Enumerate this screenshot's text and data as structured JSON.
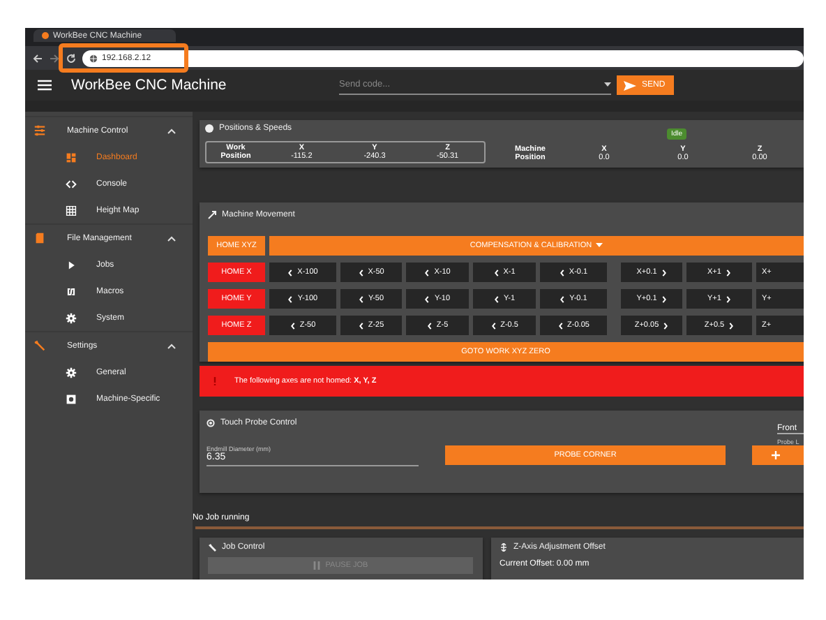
{
  "browser": {
    "tab_title": "WorkBee CNC Machine",
    "url": "192.168.2.12"
  },
  "header": {
    "title": "WorkBee CNC Machine",
    "command": {
      "placeholder": "Send code..."
    },
    "send_button": "SEND"
  },
  "sidebar": {
    "sections": [
      {
        "label": "Machine Control",
        "expanded": true,
        "children": [
          {
            "label": "Dashboard",
            "selected": true
          },
          {
            "label": "Console",
            "selected": false
          },
          {
            "label": "Height Map",
            "selected": false
          }
        ]
      },
      {
        "label": "File Management",
        "expanded": true,
        "children": [
          {
            "label": "Jobs",
            "selected": false
          },
          {
            "label": "Macros",
            "selected": false
          },
          {
            "label": "System",
            "selected": false
          }
        ]
      },
      {
        "label": "Settings",
        "expanded": true,
        "children": [
          {
            "label": "General",
            "selected": false
          },
          {
            "label": "Machine-Specific",
            "selected": false
          }
        ]
      }
    ]
  },
  "positions": {
    "title": "Positions & Speeds",
    "status": "Idle",
    "work": {
      "label_1": "Work",
      "label_2": "Position",
      "columns": [
        {
          "axis": "X",
          "value": "-115.2"
        },
        {
          "axis": "Y",
          "value": "-240.3"
        },
        {
          "axis": "Z",
          "value": "-50.31"
        }
      ]
    },
    "machine": {
      "label_1": "Machine",
      "label_2": "Position",
      "columns": [
        {
          "axis": "X",
          "value": "0.0"
        },
        {
          "axis": "Y",
          "value": "0.0"
        },
        {
          "axis": "Z",
          "value": "0.00"
        }
      ]
    }
  },
  "movement": {
    "title": "Machine Movement",
    "home_all": "HOME XYZ",
    "calibration": "COMPENSATION & CALIBRATION",
    "rows": [
      {
        "home": "HOME X",
        "jogs": [
          {
            "label": "X-100",
            "kind": "minus"
          },
          {
            "label": "X-50",
            "kind": "minus"
          },
          {
            "label": "X-10",
            "kind": "minus"
          },
          {
            "label": "X-1",
            "kind": "minus"
          },
          {
            "label": "X-0.1",
            "kind": "minus"
          },
          {
            "label": "X+0.1",
            "kind": "plus"
          },
          {
            "label": "X+1",
            "kind": "plus"
          },
          {
            "label": "X+",
            "kind": "cut"
          }
        ]
      },
      {
        "home": "HOME Y",
        "jogs": [
          {
            "label": "Y-100",
            "kind": "minus"
          },
          {
            "label": "Y-50",
            "kind": "minus"
          },
          {
            "label": "Y-10",
            "kind": "minus"
          },
          {
            "label": "Y-1",
            "kind": "minus"
          },
          {
            "label": "Y-0.1",
            "kind": "minus"
          },
          {
            "label": "Y+0.1",
            "kind": "plus"
          },
          {
            "label": "Y+1",
            "kind": "plus"
          },
          {
            "label": "Y+",
            "kind": "cut"
          }
        ]
      },
      {
        "home": "HOME Z",
        "jogs": [
          {
            "label": "Z-50",
            "kind": "minus"
          },
          {
            "label": "Z-25",
            "kind": "minus"
          },
          {
            "label": "Z-5",
            "kind": "minus"
          },
          {
            "label": "Z-0.5",
            "kind": "minus"
          },
          {
            "label": "Z-0.05",
            "kind": "minus"
          },
          {
            "label": "Z+0.05",
            "kind": "plus"
          },
          {
            "label": "Z+0.5",
            "kind": "plus"
          },
          {
            "label": "Z+",
            "kind": "cut"
          }
        ]
      }
    ],
    "goto_zero": "GOTO WORK XYZ ZERO"
  },
  "alert": {
    "text": "The following axes are not homed: **X, Y, Z**"
  },
  "probe": {
    "title": "Touch Probe Control",
    "endmill": {
      "label": "Endmill Diameter (mm)",
      "value": "6.35"
    },
    "probe_button": "PROBE CORNER",
    "side": {
      "value": "Front",
      "label": "Probe L"
    }
  },
  "job": {
    "status": "No Job running",
    "control": {
      "title": "Job Control",
      "pause_button": {
        "label": "PAUSE JOB",
        "disabled": true
      }
    },
    "z_offset": {
      "title": "Z-Axis Adjustment Offset",
      "current": "Current Offset: 0.00 mm"
    }
  }
}
